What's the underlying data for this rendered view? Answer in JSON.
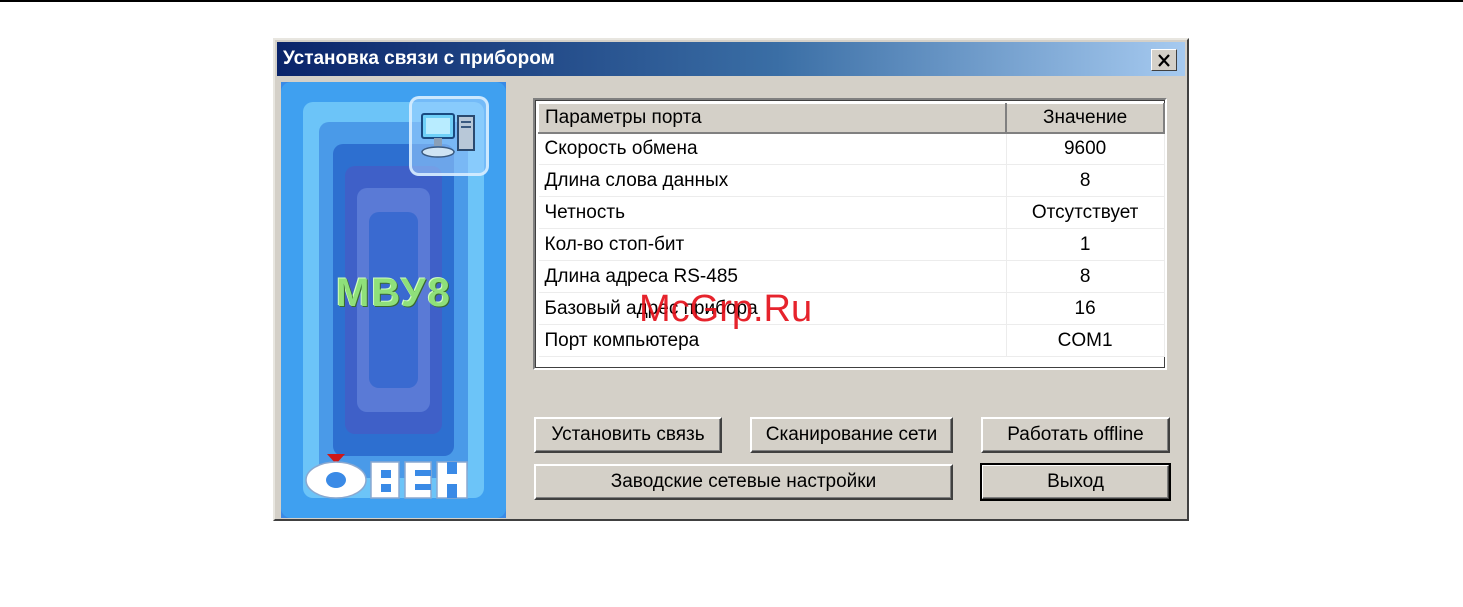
{
  "window": {
    "title": "Установка связи с прибором",
    "close_label": "✕"
  },
  "side": {
    "product_logo_text": "МВУ8",
    "brand_logo_text": "ОВЕН"
  },
  "table": {
    "headers": [
      "Параметры порта",
      "Значение"
    ],
    "rows": [
      {
        "param": "Скорость обмена",
        "value": "9600"
      },
      {
        "param": "Длина слова данных",
        "value": "8"
      },
      {
        "param": "Четность",
        "value": "Отсутствует"
      },
      {
        "param": "Кол-во стоп-бит",
        "value": "1"
      },
      {
        "param": "Длина адреса RS-485",
        "value": "8"
      },
      {
        "param": "Базовый адрес прибора",
        "value": "16"
      },
      {
        "param": "Порт компьютера",
        "value": "COM1"
      }
    ]
  },
  "buttons": {
    "connect": "Установить связь",
    "scan": "Сканирование сети",
    "offline": "Работать offline",
    "factory": "Заводские сетевые настройки",
    "exit": "Выход"
  },
  "watermark": "McGrp.Ru",
  "colors": {
    "dialog_bg": "#d4d0c8",
    "title_start": "#0a246a",
    "title_end": "#a6caf0",
    "side_blue": "#3a8ae6",
    "watermark_red": "#e4111b"
  }
}
